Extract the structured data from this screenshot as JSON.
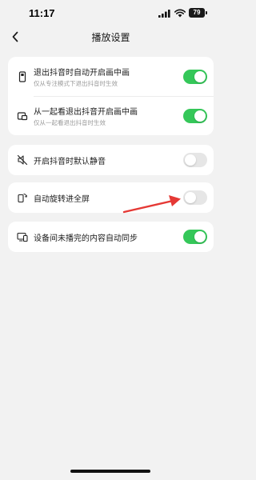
{
  "status_bar": {
    "time": "11:17",
    "battery": "79",
    "icons": [
      "signal-icon",
      "wifi-icon",
      "battery-icon"
    ]
  },
  "nav": {
    "title": "播放设置",
    "back_icon": "chevron-left-icon"
  },
  "colors": {
    "toggle_on": "#35c759",
    "toggle_off": "#e6e6e6",
    "annotation_arrow": "#e53935",
    "background": "#f2f2f2"
  },
  "settings": {
    "group1": [
      {
        "icon": "phone-portrait-icon",
        "title": "退出抖音时自动开启画中画",
        "subtitle": "仅从专注模式下退出抖音时生效",
        "enabled": true
      },
      {
        "icon": "pip-icon",
        "title": "从一起看退出抖音开启画中画",
        "subtitle": "仅从一起看退出抖音时生效",
        "enabled": true
      }
    ],
    "group2": [
      {
        "icon": "speaker-mute-icon",
        "title": "开启抖音时默认静音",
        "enabled": false
      }
    ],
    "group3": [
      {
        "icon": "rotate-screen-icon",
        "title": "自动旋转进全屏",
        "enabled": false
      }
    ],
    "group4": [
      {
        "icon": "device-sync-icon",
        "title": "设备间未播完的内容自动同步",
        "enabled": true
      }
    ]
  }
}
